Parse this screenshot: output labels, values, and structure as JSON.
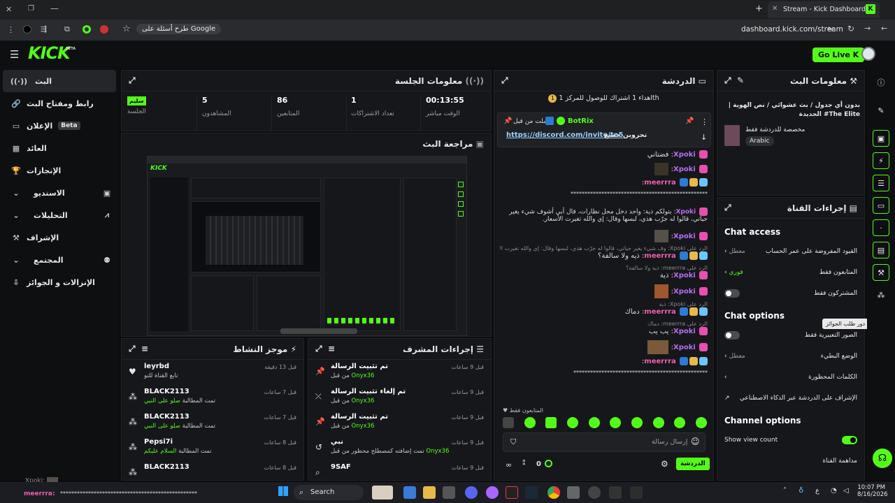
{
  "browser": {
    "tab_title": "Stream - Kick Dashboard",
    "url": "dashboard.kick.com/stream",
    "google_pill": "طرح أسئلة على Google"
  },
  "header": {
    "logo": "KICK",
    "logo_badge": "BETA",
    "go_live": "Go Live"
  },
  "nav": {
    "items": [
      {
        "label": "البث",
        "icon": "broadcast-icon"
      },
      {
        "label": "رابط ومفتاح البث",
        "icon": "link-icon"
      },
      {
        "label": "الإعلان",
        "badge": "Beta",
        "icon": "ad-icon"
      },
      {
        "label": "العائد",
        "icon": "revenue-icon"
      },
      {
        "label": "الإنجازات",
        "icon": "trophy-icon"
      },
      {
        "label": "الاستديو",
        "icon": "studio-icon"
      },
      {
        "label": "التحليلات",
        "icon": "analytics-icon"
      },
      {
        "label": "الإشراف",
        "icon": "moderation-icon"
      },
      {
        "label": "المجتمع",
        "icon": "community-icon"
      },
      {
        "label": "الإنزالات و الجوائز",
        "icon": "drops-icon"
      }
    ]
  },
  "session": {
    "title": "معلومات الجلسة",
    "stats": [
      {
        "value": "00:13:55",
        "label": "الوقت مباشر"
      },
      {
        "value": "1",
        "label": "تعداد الاشتراكات"
      },
      {
        "value": "86",
        "label": "المتابعين"
      },
      {
        "value": "5",
        "label": "المشاهدون"
      },
      {
        "value": "سليم",
        "label": "الجلسة"
      }
    ]
  },
  "preview": {
    "title": "مراجعة البث"
  },
  "activity": {
    "title": "موجز النشاط",
    "items": [
      {
        "name": "leyrbd",
        "sub": "تابع القناة للتو",
        "time": "قبل 13 دقيقة",
        "icon": "heart-icon"
      },
      {
        "name": "BLACK2113",
        "sub": "تمت المطالبة",
        "sub_hl": "صلو على النبي",
        "time": "قبل 7 ساعات",
        "icon": "reward-icon"
      },
      {
        "name": "BLACK2113",
        "sub": "تمت المطالبة",
        "sub_hl": "صلو على النبي",
        "time": "قبل 7 ساعات",
        "icon": "reward-icon"
      },
      {
        "name": "Pepsi7i",
        "sub": "تمت المطالبة",
        "sub_hl": "السلام عليكم",
        "time": "قبل 8 ساعات",
        "icon": "reward-icon"
      },
      {
        "name": "BLACK2113",
        "sub": "",
        "time": "قبل 8 ساعات",
        "icon": "reward-icon"
      }
    ]
  },
  "modactions": {
    "title": "إجراءات المشرف",
    "items": [
      {
        "name": "تم تثبيت الرسالة",
        "by": "من قبل",
        "who": "Onyx36",
        "time": "قبل 9 ساعات",
        "icon": "pin-icon"
      },
      {
        "name": "تم إلغاء تثبيت الرسالة",
        "by": "من قبل",
        "who": "Onyx36",
        "time": "قبل 9 ساعات",
        "icon": "unpin-icon"
      },
      {
        "name": "تم تثبيت الرسالة",
        "by": "من قبل",
        "who": "Onyx36",
        "time": "قبل 9 ساعات",
        "icon": "pin-icon"
      },
      {
        "name": "نبي",
        "by": "تمت إضافته كمصطلح محظور من قبل",
        "who": "Onyx36",
        "time": "قبل 9 ساعات",
        "icon": "history-icon"
      },
      {
        "name": "9SAF",
        "by": "",
        "who": "",
        "time": "قبل 9 ساعات",
        "icon": "search-icon"
      }
    ]
  },
  "chat": {
    "title": "الدردشة",
    "goal": "اهداء 1 اشتراك للوصول للمركز 1",
    "goal_th": "th",
    "pinned_by": "أرسلت من قبل",
    "pinned_user": "BotRix",
    "pinned_text": "تحروين جميع",
    "pinned_link": "https://discord.com/invite/te5",
    "messages": [
      {
        "user": "Xpoki",
        "text": "فضتاني"
      },
      {
        "user": "Xpoki",
        "text": ""
      },
      {
        "user": "meerrra",
        "text": ""
      },
      {
        "user": "",
        "text": "*************************************************"
      },
      {
        "user": "Xpoki",
        "text": "بتولكم ذية: واحد دخل محل نظارات، قال أبي أشوف شيء يغير حياتي، قالوا له جرّب هذي، لبسها وقال: إي والله تغيرت الأسعار."
      },
      {
        "user": "Xpoki",
        "text": ""
      },
      {
        "user": "meerrra",
        "text": "ذيه ولا سالفة؟",
        "reply": "الرد على Xpoki: وف شيء يغير حياتي، قالوا له جرّب هذي، لبسها وقال: إي والله تغيرت الأسعار"
      },
      {
        "user": "Xpoki",
        "text": "ذية",
        "reply": "الرد على meerrra: ذيه ولا سالفة؟"
      },
      {
        "user": "Xpoki",
        "text": ""
      },
      {
        "user": "meerrra",
        "text": "دماك",
        "reply": "الرد على Xpoki: ذية"
      },
      {
        "user": "Xpoki",
        "text": "يب يب",
        "reply": "الرد على meerrra: دماك"
      },
      {
        "user": "Xpoki",
        "text": ""
      },
      {
        "user": "meerrra",
        "text": ""
      },
      {
        "user": "",
        "text": "************************************************"
      }
    ],
    "followers_only": "المتابعون فقط",
    "input_placeholder": "إرسال رسالة",
    "send_label": "الدردشة",
    "points": "0"
  },
  "streaminfo": {
    "title": "معلومات البث",
    "stream_title": "بدون أي جدول / بث عشوائي / نص الهوية | The Elite# الجديدة",
    "category": "مخصصة للدردشة فقط",
    "language": "Arabic"
  },
  "channel": {
    "title": "إجراءات القناة",
    "chat_access": "Chat access",
    "rows_access": [
      {
        "label": "القيود المفروضة على عمر الحساب",
        "value": "معطل",
        "kind": "chevron"
      },
      {
        "label": "المتابعون فقط",
        "value": "فوري",
        "kind": "chevron",
        "green": true
      },
      {
        "label": "المشتركون فقط",
        "value": "",
        "kind": "toggle-off"
      }
    ],
    "chat_options": "Chat options",
    "rows_options": [
      {
        "label": "الصور التعبيرية فقط",
        "value": "",
        "kind": "toggle-off"
      },
      {
        "label": "الوضع البطيء",
        "value": "معطل",
        "kind": "chevron"
      },
      {
        "label": "الكلمات المحظورة",
        "value": "",
        "kind": "chevron"
      },
      {
        "label": "الإشراف على الدردشة عبر الذكاء الاصطناعي",
        "value": "",
        "kind": "external"
      }
    ],
    "channel_options": "Channel options",
    "show_view_count": "Show view count",
    "channel_watch": "مداهمة القناة",
    "tooltip": "دور طلب الجوائز"
  },
  "taskbar": {
    "search": "Search",
    "time": "10:07 PM",
    "date": "8/16/2026",
    "lang": "ع"
  },
  "overlay": {
    "xpoki_label": "Xpoki:",
    "meerrra_label": "meerrra:",
    "meerrra_text": "*************************************************"
  },
  "colors": {
    "accent": "#53fc18",
    "bg": "#0b0c0e",
    "panel": "#16171a",
    "xpoki": "#b86df5",
    "meerrra": "#ef5fb1"
  }
}
